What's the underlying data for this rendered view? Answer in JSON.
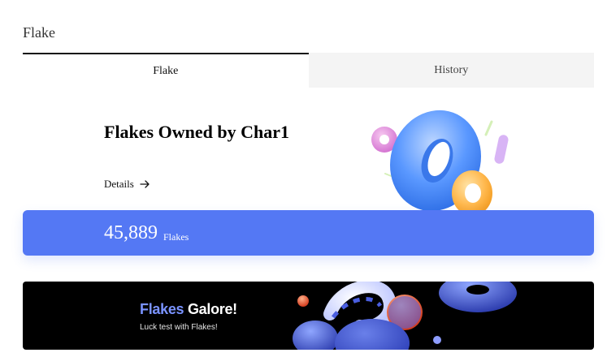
{
  "header": {
    "title": "Flake"
  },
  "tabs": [
    {
      "label": "Flake",
      "active": true
    },
    {
      "label": "History",
      "active": false
    }
  ],
  "owned": {
    "title": "Flakes Owned by Char1",
    "details_label": "Details"
  },
  "balance": {
    "value": "45,889",
    "unit": "Flakes"
  },
  "banner": {
    "title_accent": "Flakes",
    "title_rest": "Galore!",
    "subtitle": "Luck test with Flakes!"
  },
  "colors": {
    "accent": "#5478f4",
    "banner_accent": "#7a93ff",
    "banner_bg": "#000000"
  },
  "icons": {
    "details_arrow": "arrow-right-icon"
  }
}
